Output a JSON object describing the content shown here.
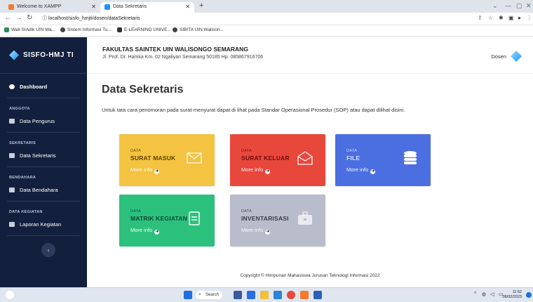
{
  "browser": {
    "tabs": [
      {
        "label": "Welcome to XAMPP",
        "active": false
      },
      {
        "label": "Data Sekretaris",
        "active": true
      }
    ],
    "new_tab": "+",
    "url_host": "localhost",
    "url_path": "/sisfo_hmjti/dosen/dataSekretaris",
    "bookmarks": [
      "Wali-SIAdik UIN Wa...",
      "Sistem Informasi Tu...",
      "E-LEARNING UNIVE...",
      "SIBITA UIN Walison..."
    ]
  },
  "sidebar": {
    "brand": "SISFO-HMJ TI",
    "dashboard": "Dashboard",
    "sections": [
      {
        "heading": "ANGGOTA",
        "item": "Data Pengurus"
      },
      {
        "heading": "SEKRETARIS",
        "item": "Data Sekretaris"
      },
      {
        "heading": "BENDAHARA",
        "item": "Data Bendahara"
      },
      {
        "heading": "DATA KEGIATAN",
        "item": "Laporan Kegiatan"
      }
    ],
    "toggle": "‹"
  },
  "header": {
    "faculty": "FAKULTAS SAINTEK UIN WALISONGO SEMARANG",
    "address": "Jl. Prof. Dr. Hamka Km. 02 Ngaliyan Semarang 50185 Hp. 085867916706",
    "user": "Dosen"
  },
  "main": {
    "title": "Data Sekretaris",
    "notice": "Untuk tata cara penomoran pada surat-menyurat dapat di lihat pada Standar Operasional Prosedur (SOP) atau dapat dilihat disini.",
    "cards": [
      {
        "label": "DATA",
        "title": "SURAT MASUK",
        "more": "More info",
        "color": "#f3c341",
        "icon": "envelope-icon"
      },
      {
        "label": "DATA",
        "title": "SURAT KELUAR",
        "more": "More info",
        "color": "#e8473c",
        "icon": "envelope-open-icon"
      },
      {
        "label": "DATA",
        "title": "FILE",
        "more": "More info",
        "color": "#4b6fe0",
        "icon": "database-icon"
      },
      {
        "label": "DATA",
        "title": "MATRIK KEGIATAN",
        "more": "More info",
        "color": "#2bc17c",
        "icon": "book-icon"
      },
      {
        "label": "DATA",
        "title": "INVENTARISASI",
        "more": "More info",
        "color": "#b9bccb",
        "icon": "briefcase-icon"
      }
    ]
  },
  "footer": {
    "copyright": "Copyright © Himpunan Mahasiswa Jurusan Teknologi Informasi 2022"
  },
  "taskbar": {
    "search": "Search",
    "time": "11:52",
    "date": "08/02/2023"
  }
}
